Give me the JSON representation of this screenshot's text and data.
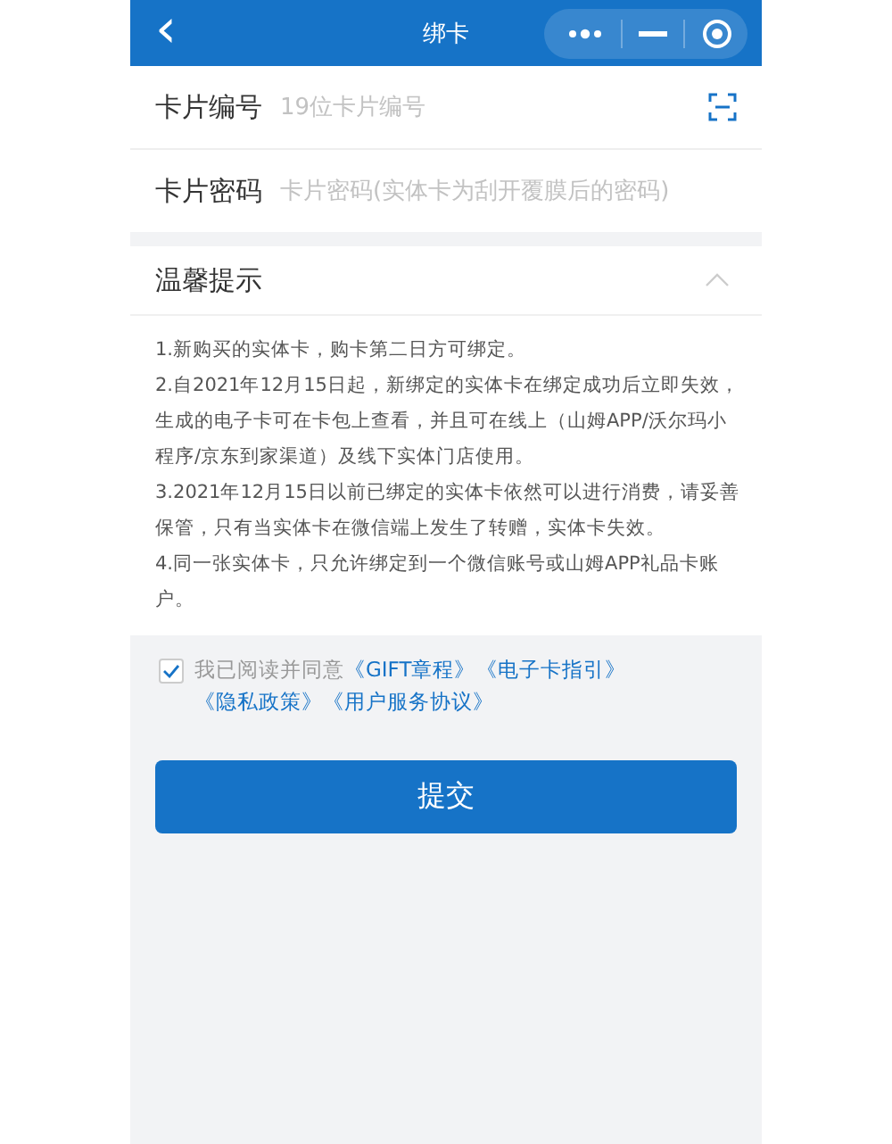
{
  "header": {
    "back": "‹",
    "title": "绑卡"
  },
  "fields": [
    {
      "label": "卡片编号",
      "placeholder": "19位卡片编号",
      "scan": true
    },
    {
      "label": "卡片密码",
      "placeholder": "卡片密码(实体卡为刮开覆膜后的密码)",
      "scan": false
    }
  ],
  "tips": {
    "title": "温馨提示",
    "expanded": true,
    "items": [
      "1.新购买的实体卡，购卡第二日方可绑定。",
      "2.自2021年12月15日起，新绑定的实体卡在绑定成功后立即失效，生成的电子卡可在卡包上查看，并且可在线上（山姆APP/沃尔玛小程序/京东到家渠道）及线下实体门店使用。",
      "3.2021年12月15日以前已绑定的实体卡依然可以进行消费，请妥善保管，只有当实体卡在微信端上发生了转赠，实体卡失效。",
      "4.同一张实体卡，只允许绑定到一个微信账号或山姆APP礼品卡账户。"
    ]
  },
  "agreement": {
    "checked": true,
    "prefix": "我已阅读并同意",
    "links": [
      "《GIFT章程》",
      "《电子卡指引》",
      "《隐私政策》",
      "《用户服务协议》"
    ]
  },
  "submit": "提交"
}
